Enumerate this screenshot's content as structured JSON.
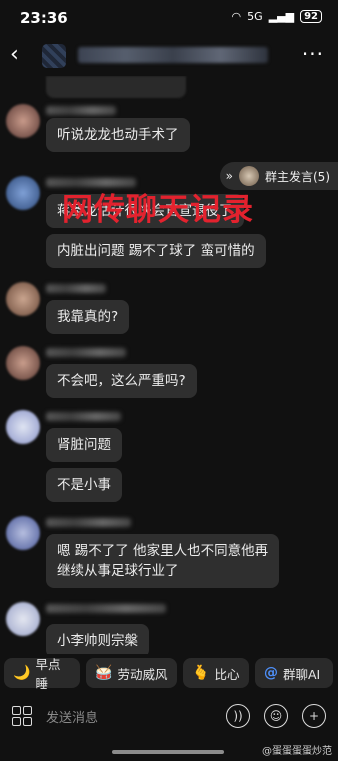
{
  "status": {
    "time": "23:36",
    "battery": "92",
    "network": "5G"
  },
  "header": {
    "back_icon": "chevron-left-icon",
    "more_icon": "ellipsis-icon"
  },
  "owner_pill": {
    "label": "群主发言(5)"
  },
  "overlay": {
    "text": "网传聊天记录"
  },
  "messages": [
    {
      "text": "听说龙龙也动手术了"
    },
    {
      "text": "蒋圣龙估计很快会官宣退役了"
    },
    {
      "text": "内脏出问题 踢不了球了 蛮可惜的"
    },
    {
      "text": "我靠真的?"
    },
    {
      "text": "不会吧，这么严重吗?"
    },
    {
      "text": "肾脏问题"
    },
    {
      "text": "不是小事"
    },
    {
      "text": "嗯 踢不了了 他家里人也不同意他再\n继续从事足球行业了"
    },
    {
      "text": "小李帅则宗槃"
    }
  ],
  "quick_actions": [
    {
      "label": "早点睡",
      "icon": "moon-icon"
    },
    {
      "label": "劳动威风",
      "icon": "drum-icon"
    },
    {
      "label": "比心",
      "icon": "heart-hand-icon"
    },
    {
      "label": "群聊AI",
      "icon": "at-icon"
    }
  ],
  "input": {
    "placeholder": "发送消息"
  },
  "watermark": "@蛋蛋蛋蛋炒范"
}
